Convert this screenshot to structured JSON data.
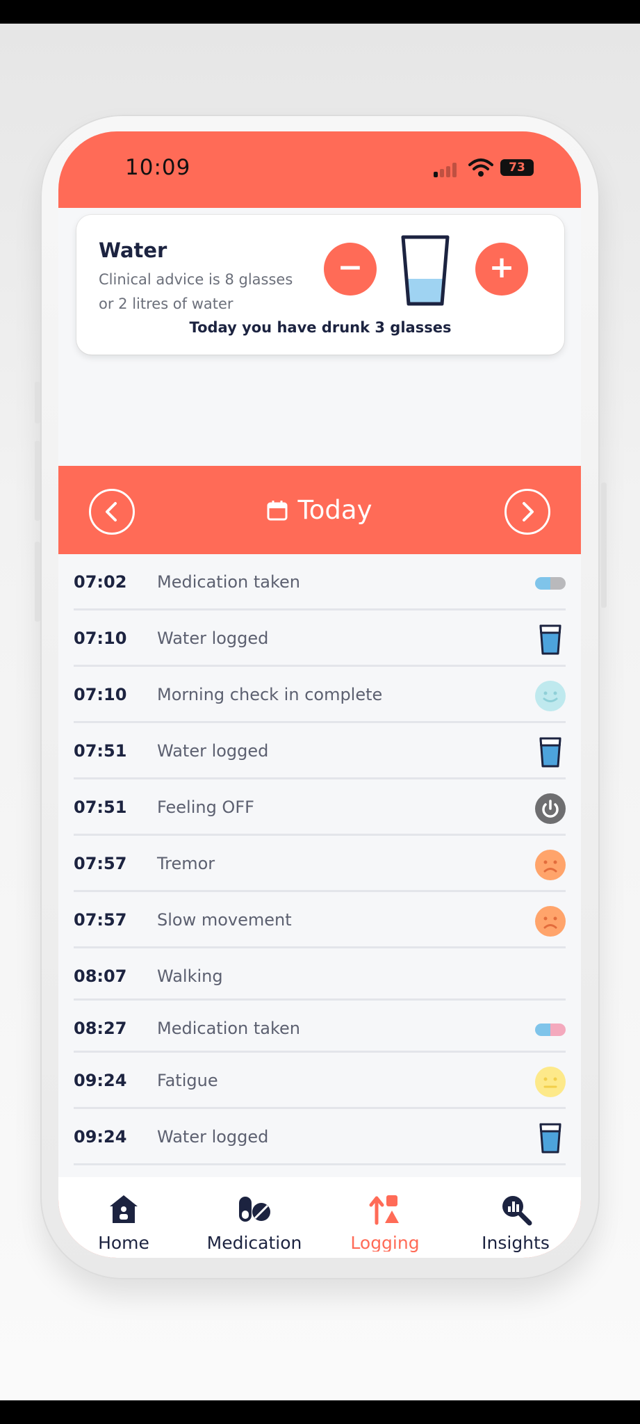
{
  "status_bar": {
    "time": "10:09",
    "battery": "73"
  },
  "water": {
    "title": "Water",
    "advice": "Clinical advice is 8 glasses or 2 litres of water",
    "summary": "Today you have drunk 3 glasses",
    "decrease_symbol": "−",
    "increase_symbol": "+",
    "glass_fill_fraction": 0.375
  },
  "date_nav": {
    "label": "Today"
  },
  "log": [
    {
      "time": "07:02",
      "label": "Medication taken",
      "icon": "pill-icon"
    },
    {
      "time": "07:10",
      "label": "Water logged",
      "icon": "water-glass-icon"
    },
    {
      "time": "07:10",
      "label": "Morning check in complete",
      "icon": "smile-face-icon"
    },
    {
      "time": "07:51",
      "label": "Water logged",
      "icon": "water-glass-icon"
    },
    {
      "time": "07:51",
      "label": "Feeling OFF",
      "icon": "power-icon"
    },
    {
      "time": "07:57",
      "label": "Tremor",
      "icon": "sad-face-icon"
    },
    {
      "time": "07:57",
      "label": "Slow movement",
      "icon": "sad-face-icon"
    },
    {
      "time": "08:07",
      "label": "Walking",
      "icon": ""
    },
    {
      "time": "08:27",
      "label": "Medication taken",
      "icon": "pill-icon"
    },
    {
      "time": "09:24",
      "label": "Fatigue",
      "icon": "neutral-face-icon"
    },
    {
      "time": "09:24",
      "label": "Water logged",
      "icon": "water-glass-icon"
    }
  ],
  "tabs": [
    {
      "label": "Home",
      "icon": "home-icon"
    },
    {
      "label": "Medication",
      "icon": "medication-icon"
    },
    {
      "label": "Logging",
      "icon": "logging-icon",
      "active": true
    },
    {
      "label": "Insights",
      "icon": "insights-icon"
    }
  ],
  "colors": {
    "accent": "#ff6b57",
    "text_dark": "#1c2340",
    "water_blue": "#4da3dc"
  }
}
